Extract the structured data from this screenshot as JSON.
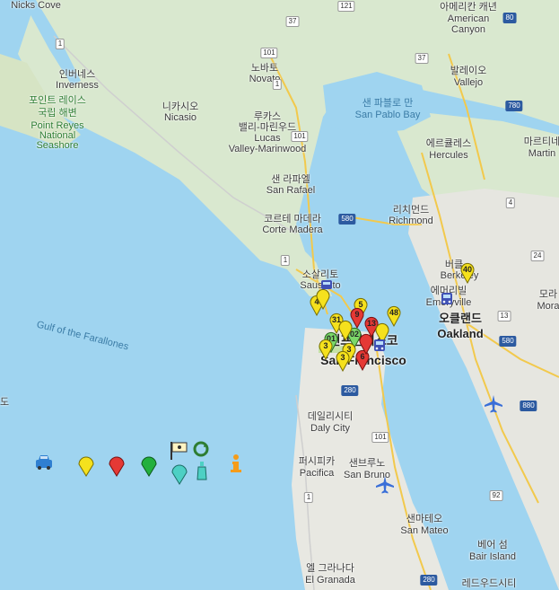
{
  "map": {
    "labels": {
      "nicks_cove": "Nicks Cove",
      "inverness_ko": "인버네스",
      "inverness": "Inverness",
      "point_reyes_ko1": "포인트 레이스",
      "point_reyes_ko2": "국립 해변",
      "point_reyes_1": "Point Reyes",
      "point_reyes_2": "National",
      "point_reyes_3": "Seashore",
      "novato_ko": "노바토",
      "novato": "Novato",
      "nicasio_ko": "니카시오",
      "nicasio": "Nicasio",
      "lucas_ko1": "루카스",
      "lucas_ko2": "밸리-마린우드",
      "lucas_1": "Lucas",
      "lucas_2": "Valley-Marinwood",
      "san_rafael_ko": "샌 라파엘",
      "san_rafael": "San Rafael",
      "corte_madera_ko": "코르테 마데라",
      "corte_madera": "Corte Madera",
      "sausalito_ko": "소살리토",
      "sausalito": "Sausalito",
      "american_canyon_ko": "아메리칸 캐년",
      "american_canyon_1": "American",
      "american_canyon_2": "Canyon",
      "vallejo_ko": "발레이오",
      "vallejo": "Vallejo",
      "san_pablo_bay_ko": "샌 파블로 만",
      "san_pablo_bay": "San Pablo Bay",
      "martinez_ko": "마르티네",
      "martinez": "Martin",
      "hercules_ko": "에르큘레스",
      "hercules": "Hercules",
      "richmond_ko": "리치먼드",
      "richmond": "Richmond",
      "berkeley_ko": "버클",
      "berkeley": "Berkeley",
      "emeryville_ko": "에머리빌",
      "emeryville": "Emeryville",
      "oakland_ko": "오클랜드",
      "oakland": "Oakland",
      "moraga_ko": "모라",
      "moraga": "Mora",
      "sf_ko": "샌프란시스코",
      "sf": "San Francisco",
      "gulf": "Gulf of the Farallones",
      "daly_city_ko": "데일리시티",
      "daly_city": "Daly City",
      "pacifica_ko": "퍼시피카",
      "pacifica": "Pacifica",
      "san_bruno_ko": "샌브루노",
      "san_bruno": "San Bruno",
      "san_mateo_ko": "샌마테오",
      "san_mateo": "San Mateo",
      "bair_island_ko": "베어 섬",
      "bair_island": "Bair Island",
      "el_granada_ko": "엘 그라나다",
      "el_granada": "El Granada",
      "redwood_ko": "레드우드시티",
      "left_edge": "도"
    },
    "shields": {
      "r1a": "1",
      "r1b": "1",
      "r1c": "1",
      "r1d": "1",
      "r101a": "101",
      "r101b": "101",
      "r101c": "101",
      "r121": "121",
      "r37a": "37",
      "r37b": "37",
      "i80a": "80",
      "i780": "780",
      "i580a": "580",
      "i580b": "580",
      "i880": "880",
      "i280a": "280",
      "i280b": "280",
      "r4": "4",
      "r24": "24",
      "r13": "13",
      "r92": "92"
    },
    "markers": [
      {
        "label": "40",
        "color": "#f5e11d"
      },
      {
        "label": "4",
        "color": "#f5e11d"
      },
      {
        "label": "5",
        "color": "#f5e11d"
      },
      {
        "label": "48",
        "color": "#f5e11d"
      },
      {
        "label": "31",
        "color": "#f5e11d"
      },
      {
        "label": "9",
        "color": "#e53935"
      },
      {
        "label": "13",
        "color": "#e53935"
      },
      {
        "label": "01",
        "color": "#7cd86a"
      },
      {
        "label": "02",
        "color": "#7cd86a"
      },
      {
        "label": "3",
        "color": "#f5e11d"
      },
      {
        "label": "3",
        "color": "#f5e11d"
      },
      {
        "label": "3",
        "color": "#f5e11d"
      },
      {
        "label": "6",
        "color": "#e53935"
      }
    ],
    "legend": [
      "taxi-icon",
      "yellow-pin-icon",
      "red-pin-icon",
      "green-pin-icon",
      "flag-icon",
      "recycle-icon",
      "teal-pin-icon",
      "info-icon"
    ]
  }
}
